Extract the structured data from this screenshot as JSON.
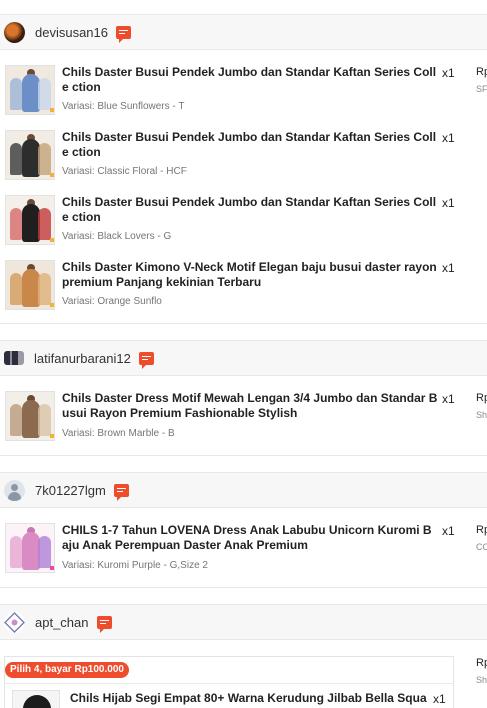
{
  "orders": [
    {
      "shop": "devisusan16",
      "items": [
        {
          "title": "Chils Daster Busui Pendek Jumbo dan Standar Kaftan Series Colle ction",
          "qty": "x1",
          "variant": "Variasi: Blue Sunflowers - T",
          "price": "Rp",
          "price_sub": "SF"
        },
        {
          "title": "Chils Daster Busui Pendek Jumbo dan Standar Kaftan Series Colle ction",
          "qty": "x1",
          "variant": "Variasi: Classic Floral - HCF"
        },
        {
          "title": "Chils Daster Busui Pendek Jumbo dan Standar Kaftan Series Colle ction",
          "qty": "x1",
          "variant": "Variasi: Black Lovers - G"
        },
        {
          "title": "Chils Daster Kimono V-Neck Motif Elegan baju busui daster rayon premium Panjang kekinian Terbaru",
          "qty": "x1",
          "variant": "Variasi: Orange Sunflo"
        }
      ]
    },
    {
      "shop": "latifanurbarani12",
      "items": [
        {
          "title": "Chils Daster Dress Motif Mewah Lengan 3/4 Jumbo dan Standar B usui Rayon Premium Fashionable Stylish",
          "qty": "x1",
          "variant": "Variasi: Brown Marble - B",
          "price": "Rp",
          "price_sub": "Sh"
        }
      ]
    },
    {
      "shop": "7k01227lgm",
      "items": [
        {
          "title": "CHILS 1-7 Tahun LOVENA Dress Anak Labubu Unicorn Kuromi Baju Anak Perempuan Daster Anak Premium",
          "qty": "x1",
          "variant": "Variasi: Kuromi Purple - G,Size 2",
          "price": "Rp",
          "price_sub": "CO"
        }
      ]
    },
    {
      "shop": "apt_chan",
      "promo": "Pilih 4, bayar Rp100.000",
      "price": "Rp",
      "price_sub": "Sh",
      "items": [
        {
          "title": "Chils Hijab Segi Empat 80+ Warna Kerudung Jilbab Bella Squar",
          "qty": "x1"
        }
      ]
    }
  ],
  "colors": {
    "accent": "#ee4d2d",
    "header_bg": "#f7f7f7"
  }
}
